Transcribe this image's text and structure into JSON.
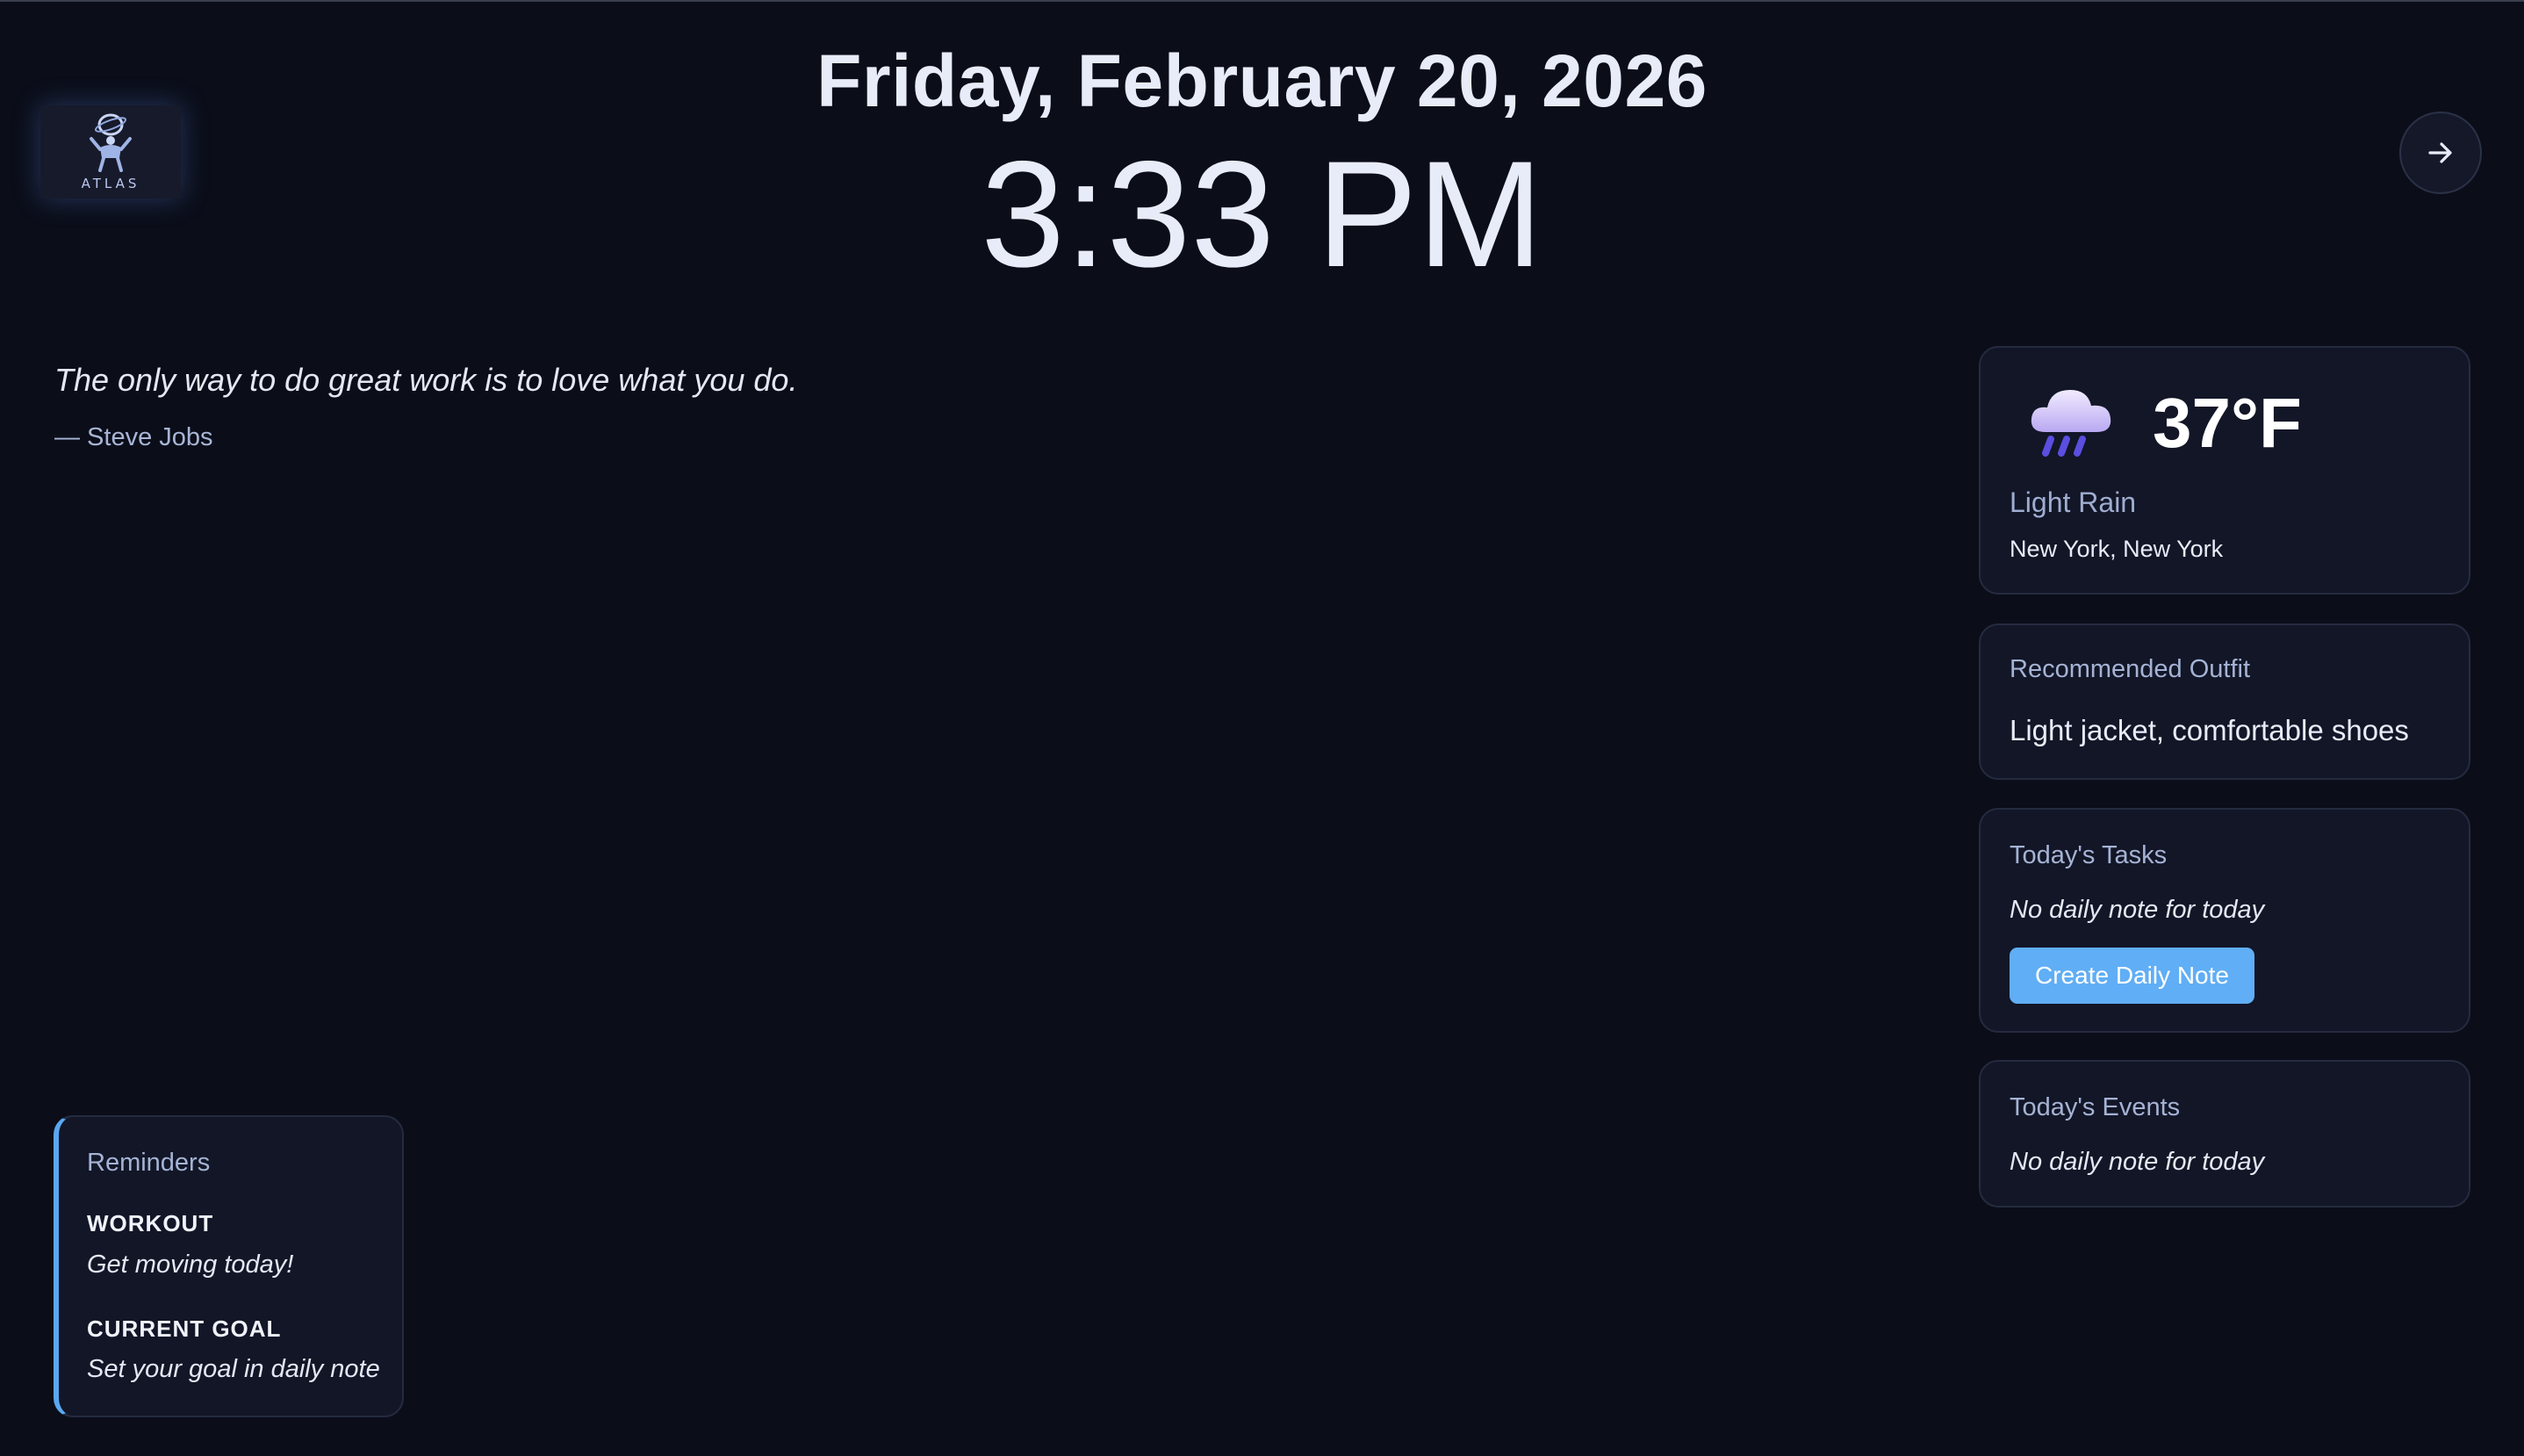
{
  "logo": {
    "text": "ATLAS",
    "icon": "atlas-figure-logo"
  },
  "header": {
    "date": "Friday, February 20, 2026",
    "time": "3:33 PM",
    "next_icon": "arrow-right-icon"
  },
  "quote": {
    "text": "The only way to do great work is to love what you do.",
    "author": "— Steve Jobs"
  },
  "weather": {
    "icon": "rain-cloud-icon",
    "temperature": "37°F",
    "condition": "Light Rain",
    "location": "New York, New York"
  },
  "outfit": {
    "title": "Recommended Outfit",
    "text": "Light jacket, comfortable shoes"
  },
  "tasks": {
    "title": "Today's Tasks",
    "note": "No daily note for today",
    "button_label": "Create Daily Note"
  },
  "events": {
    "title": "Today's Events",
    "note": "No daily note for today"
  },
  "reminders": {
    "title": "Reminders",
    "items": [
      {
        "label": "WORKOUT",
        "text": "Get moving today!"
      },
      {
        "label": "CURRENT GOAL",
        "text": "Set your goal in daily note"
      }
    ]
  },
  "colors": {
    "background": "#0b0e19",
    "card": "#121627",
    "accent": "#60aef5"
  }
}
